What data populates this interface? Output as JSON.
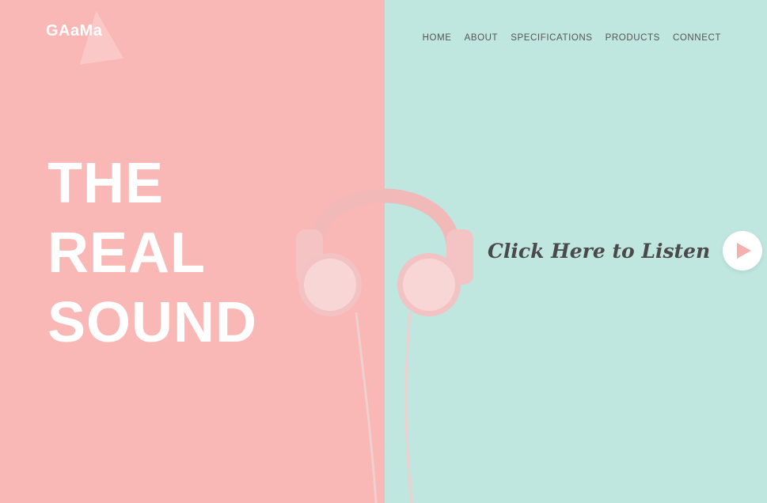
{
  "brand": {
    "logo_text": "GAaMa"
  },
  "nav": {
    "items": [
      "HOME",
      "ABOUT",
      "SPECIFICATIONS",
      "PRODUCTS",
      "CONNECT"
    ]
  },
  "hero": {
    "line1": "THE",
    "line2": "REAL",
    "line3": "SOUND"
  },
  "cta": {
    "label": "Click Here to Listen",
    "icon": "play-icon"
  },
  "colors": {
    "left_bg": "#f9b7b5",
    "right_bg": "#bfe6df",
    "hero_text": "#ffffff",
    "nav_text": "#555555"
  }
}
